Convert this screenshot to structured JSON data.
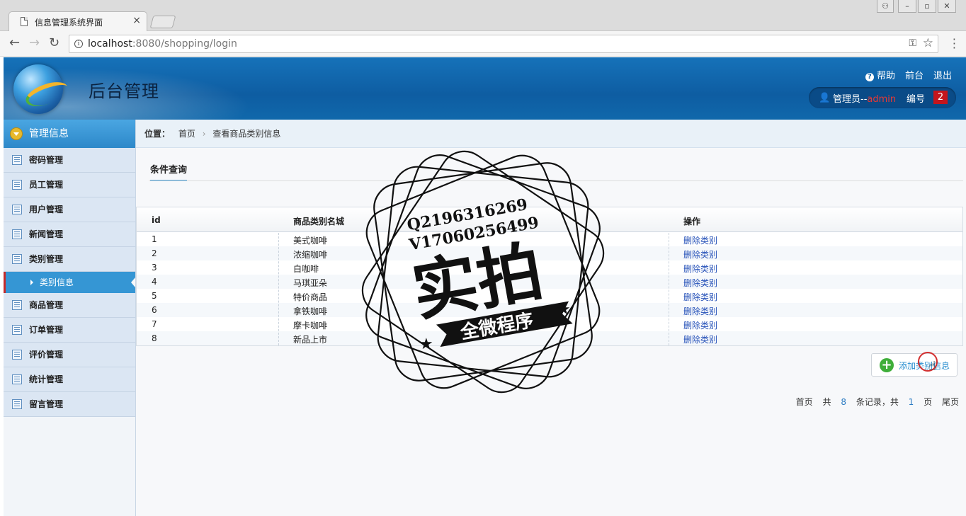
{
  "browser": {
    "tab_title": "信息管理系统界面",
    "tab_close": "×",
    "url_host": "localhost",
    "url_rest": ":8080/shopping/login"
  },
  "header": {
    "title": "后台管理",
    "links": {
      "help": "帮助",
      "front": "前台",
      "logout": "退出"
    },
    "user_prefix": "管理员--",
    "user_name": "admin",
    "id_label": "编号",
    "id_value": "2"
  },
  "sidebar": {
    "heading": "管理信息",
    "items": [
      {
        "label": "密码管理"
      },
      {
        "label": "员工管理"
      },
      {
        "label": "用户管理"
      },
      {
        "label": "新闻管理"
      },
      {
        "label": "类别管理"
      }
    ],
    "active_sub": "类别信息",
    "items_after": [
      {
        "label": "商品管理"
      },
      {
        "label": "订单管理"
      },
      {
        "label": "评价管理"
      },
      {
        "label": "统计管理"
      },
      {
        "label": "留言管理"
      }
    ]
  },
  "breadcrumb": {
    "label": "位置：",
    "home": "首页",
    "sep": "›",
    "current": "查看商品类别信息"
  },
  "filter": {
    "tab": "条件查询"
  },
  "table": {
    "columns": [
      "id",
      "商品类别名城",
      "操作"
    ],
    "rows": [
      {
        "id": "1",
        "name": "美式咖啡",
        "action": "删除类别"
      },
      {
        "id": "2",
        "name": "浓缩咖啡",
        "action": "删除类别"
      },
      {
        "id": "3",
        "name": "白咖啡",
        "action": "删除类别"
      },
      {
        "id": "4",
        "name": "马琪亚朵",
        "action": "删除类别"
      },
      {
        "id": "5",
        "name": "特价商品",
        "action": "删除类别"
      },
      {
        "id": "6",
        "name": "拿铁咖啡",
        "action": "删除类别"
      },
      {
        "id": "7",
        "name": "摩卡咖啡",
        "action": "删除类别"
      },
      {
        "id": "8",
        "name": "新品上市",
        "action": "删除类别"
      }
    ]
  },
  "add_button": {
    "label": "添加类别信息"
  },
  "pager": {
    "first": "首页",
    "total_prefix": "共",
    "total": "8",
    "total_suffix": "条记录，共",
    "pages": "1",
    "pages_suffix": "页",
    "last": "尾页"
  },
  "watermark": {
    "line1": "Q2196316269",
    "line2": "V17060256499",
    "main": "实拍",
    "ribbon": "全微程序"
  },
  "colors": {
    "header_blue": "#0e5da2",
    "sidebar_active": "#3596d4",
    "link_blue": "#2450b8",
    "badge_red": "#c4151c",
    "add_green": "#3fae3a"
  }
}
